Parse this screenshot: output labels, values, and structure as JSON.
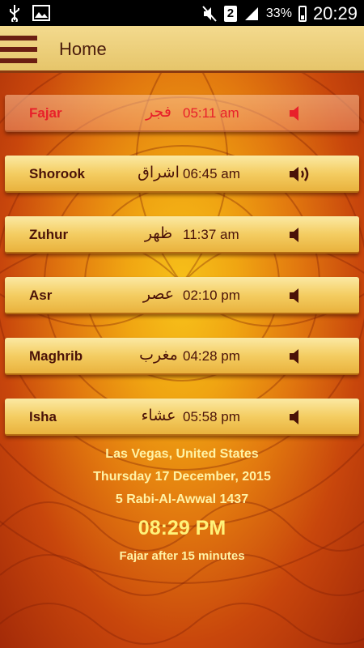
{
  "status_bar": {
    "battery": "33%",
    "time": "20:29",
    "sim": "2"
  },
  "app_bar": {
    "title": "Home"
  },
  "prayers": [
    {
      "name": "Fajar",
      "arabic": "فجر",
      "time": "05:11 am",
      "sound": "speaker-icon",
      "active": true
    },
    {
      "name": "Shorook",
      "arabic": "اشراق",
      "time": "06:45 am",
      "sound": "speaker-loud-icon",
      "active": false
    },
    {
      "name": "Zuhur",
      "arabic": "ظهر",
      "time": "11:37 am",
      "sound": "speaker-icon",
      "active": false
    },
    {
      "name": "Asr",
      "arabic": "عصر",
      "time": "02:10 pm",
      "sound": "speaker-icon",
      "active": false
    },
    {
      "name": "Maghrib",
      "arabic": "مغرب",
      "time": "04:28 pm",
      "sound": "speaker-icon",
      "active": false
    },
    {
      "name": "Isha",
      "arabic": "عشاء",
      "time": "05:58 pm",
      "sound": "speaker-icon",
      "active": false
    }
  ],
  "info": {
    "location": "Las Vegas, United States",
    "date": "Thursday 17 December, 2015",
    "hijri_date": "5 Rabi-Al-Awwal 1437",
    "clock": "08:29 PM",
    "next_prayer": "Fajar after 15 minutes"
  },
  "colors": {
    "active_text": "#e8202a",
    "text_dark": "#4a1208",
    "info_text": "#fff3a6"
  }
}
